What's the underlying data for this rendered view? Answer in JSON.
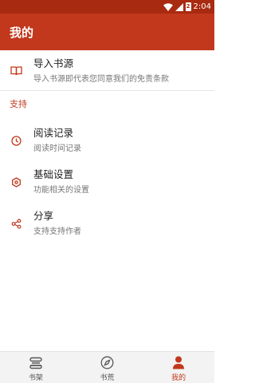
{
  "status_bar": {
    "time": "2:04",
    "battery": "2"
  },
  "app_bar": {
    "title": "我的"
  },
  "rows": {
    "import": {
      "title": "导入书源",
      "subtitle": "导入书源即代表您同意我们的免责条款"
    },
    "reading": {
      "title": "阅读记录",
      "subtitle": "阅读时间记录"
    },
    "settings": {
      "title": "基础设置",
      "subtitle": "功能相关的设置"
    },
    "share": {
      "title": "分享",
      "subtitle": "支持支持作者"
    }
  },
  "section": {
    "support": "支持"
  },
  "bottom_nav": {
    "items": [
      {
        "label": "书架",
        "icon": "bookshelf-icon"
      },
      {
        "label": "书荒",
        "icon": "compass-icon"
      },
      {
        "label": "我的",
        "icon": "person-icon"
      }
    ],
    "active": "我的"
  },
  "colors": {
    "primary": "#c1381c",
    "status_bar": "#a82a10",
    "accent_icon": "#c1381c"
  }
}
